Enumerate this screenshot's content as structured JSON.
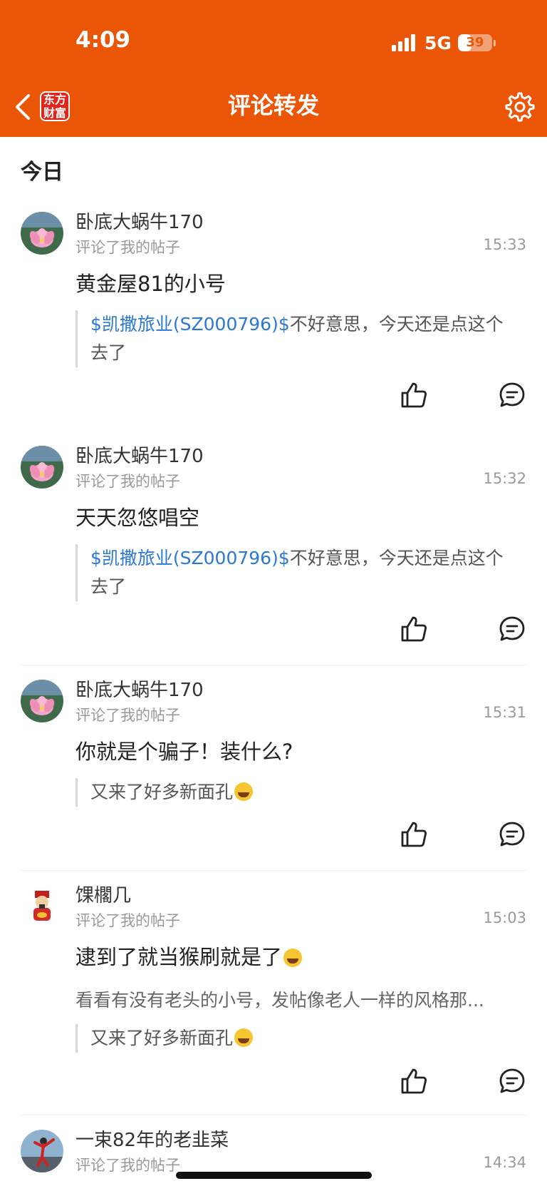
{
  "status_bar": {
    "time": "4:09",
    "network": "5G",
    "battery": "39",
    "battery_level": 0.39
  },
  "header": {
    "title": "评论转发",
    "logo_line1": "东方",
    "logo_line2": "财富"
  },
  "section": {
    "title": "今日"
  },
  "comments": [
    {
      "username": "卧底大蜗牛170",
      "action": "评论了我的帖子",
      "time": "15:33",
      "text": "黄金屋81的小号",
      "quote_stock": "$凯撒旅业(SZ000796)$",
      "quote_rest": "不好意思，今天还是点这个",
      "quote_line2": "去了",
      "avatar": "lotus"
    },
    {
      "username": "卧底大蜗牛170",
      "action": "评论了我的帖子",
      "time": "15:32",
      "text": "天天忽悠唱空",
      "quote_stock": "$凯撒旅业(SZ000796)$",
      "quote_rest": "不好意思，今天还是点这个",
      "quote_line2": "去了",
      "avatar": "lotus"
    },
    {
      "username": "卧底大蜗牛170",
      "action": "评论了我的帖子",
      "time": "15:31",
      "text": "你就是个骗子！装什么?",
      "quote": "又来了好多新面孔",
      "quote_emoji": "laughing-crying-emoji",
      "avatar": "lotus"
    },
    {
      "username": "馃櫊几",
      "action": "评论了我的帖子",
      "time": "15:03",
      "text": "逮到了就当猴刷就是了",
      "text_emoji": "grinning-emoji",
      "secondary": "看看有没有老头的小号，发帖像老人一样的风格那...",
      "quote": "又来了好多新面孔",
      "quote_emoji": "laughing-crying-emoji",
      "avatar": "god-of-wealth"
    },
    {
      "username": "一束82年的老韭菜",
      "action": "评论了我的帖子",
      "time": "14:34",
      "avatar": "dancer"
    }
  ]
}
